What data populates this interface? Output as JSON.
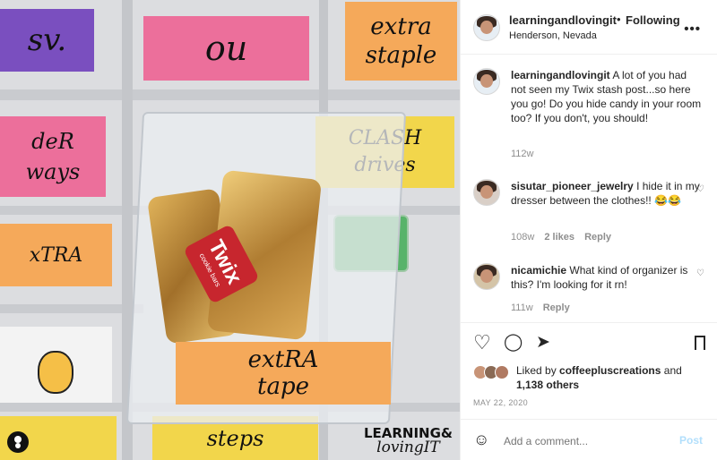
{
  "photo": {
    "labels": {
      "top_left": "sv.",
      "top_center": "ou",
      "top_right_line1": "extra",
      "top_right_line2": "staple",
      "mid_left_line1": "deR",
      "mid_left_line2": "ways",
      "mid_right_line1": "CLASH",
      "mid_right_line2": "drives",
      "low_left_line1": "xTRA",
      "front_line1": "extRA",
      "front_line2": "tape",
      "bottom_center": "steps"
    },
    "candy_brand": "Twix",
    "candy_sub": "cookie bars",
    "watermark_line1": "LEARNING&",
    "watermark_line2": "lovingIT",
    "colors": {
      "pink": "#ec6f9b",
      "purple": "#7a4fbf",
      "orange": "#f5a95a",
      "yellow": "#f2d64b",
      "gold": "#c6913e"
    }
  },
  "header": {
    "username": "learningandlovingit",
    "separator": "•",
    "follow_label": "Following",
    "location": "Henderson, Nevada",
    "more_icon": "•••"
  },
  "comments": [
    {
      "user": "learningandlovingit",
      "text": "A lot of you had not seen my Twix stash post...so here you go! Do you hide candy in your room too? If you don't, you should!",
      "time": "112w",
      "likes": "",
      "reply": ""
    },
    {
      "user": "sisutar_pioneer_jewelry",
      "text": "I hide it in my dresser between the clothes!! 😂😂",
      "time": "108w",
      "likes": "2 likes",
      "reply": "Reply"
    },
    {
      "user": "nicamichie",
      "text": "What kind of organizer is this? I'm looking for it rn!",
      "time": "111w",
      "likes": "",
      "reply": "Reply"
    }
  ],
  "actions": {
    "like_icon": "♡",
    "comment_icon": "◯",
    "share_icon": "➤",
    "save_icon": "⊓"
  },
  "likes": {
    "prefix": "Liked by",
    "user": "coffeepluscreations",
    "and": "and",
    "others": "1,138 others"
  },
  "date": "MAY 22, 2020",
  "add_comment": {
    "emoji_icon": "☺",
    "placeholder": "Add a comment...",
    "post_label": "Post"
  }
}
